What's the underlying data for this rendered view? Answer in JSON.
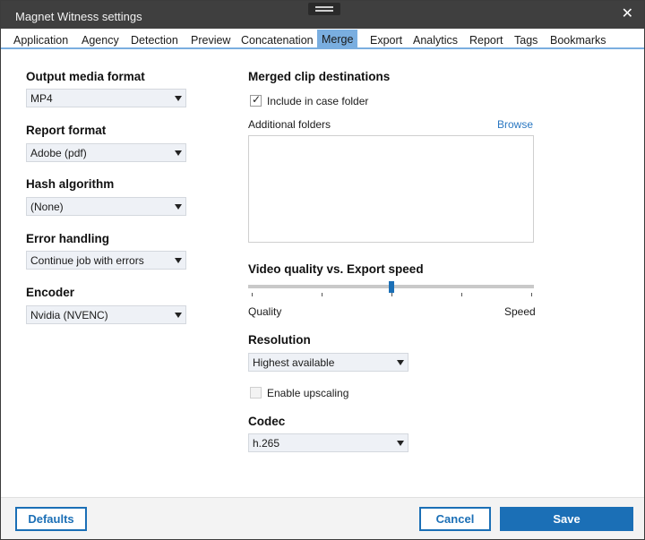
{
  "window": {
    "title": "Magnet Witness settings"
  },
  "tabs": [
    {
      "label": "Application"
    },
    {
      "label": "Agency"
    },
    {
      "label": "Detection"
    },
    {
      "label": "Preview"
    },
    {
      "label": "Concatenation"
    },
    {
      "label": "Merge",
      "active": true
    },
    {
      "label": "Export"
    },
    {
      "label": "Analytics"
    },
    {
      "label": "Report"
    },
    {
      "label": "Tags"
    },
    {
      "label": "Bookmarks"
    }
  ],
  "left": {
    "output_media_format": {
      "label": "Output media format",
      "value": "MP4"
    },
    "report_format": {
      "label": "Report format",
      "value": "Adobe (pdf)"
    },
    "hash_algorithm": {
      "label": "Hash algorithm",
      "value": "(None)"
    },
    "error_handling": {
      "label": "Error handling",
      "value": "Continue job with errors"
    },
    "encoder": {
      "label": "Encoder",
      "value": "Nvidia (NVENC)"
    }
  },
  "right": {
    "merged_clip_destinations": {
      "label": "Merged clip destinations",
      "include_in_case_folder": {
        "label": "Include in case folder",
        "checked": true
      },
      "additional_folders_label": "Additional folders",
      "browse_label": "Browse"
    },
    "video_quality": {
      "label": "Video quality vs. Export speed",
      "min_label": "Quality",
      "max_label": "Speed",
      "value_fraction": 0.5
    },
    "resolution": {
      "label": "Resolution",
      "value": "Highest available",
      "enable_upscaling": {
        "label": "Enable upscaling",
        "checked": false,
        "enabled": false
      }
    },
    "codec": {
      "label": "Codec",
      "value": "h.265"
    }
  },
  "footer": {
    "defaults_label": "Defaults",
    "cancel_label": "Cancel",
    "save_label": "Save"
  },
  "colors": {
    "accent": "#1b6fb6",
    "tab_active": "#7aaee0",
    "titlebar": "#3f3f3f"
  }
}
